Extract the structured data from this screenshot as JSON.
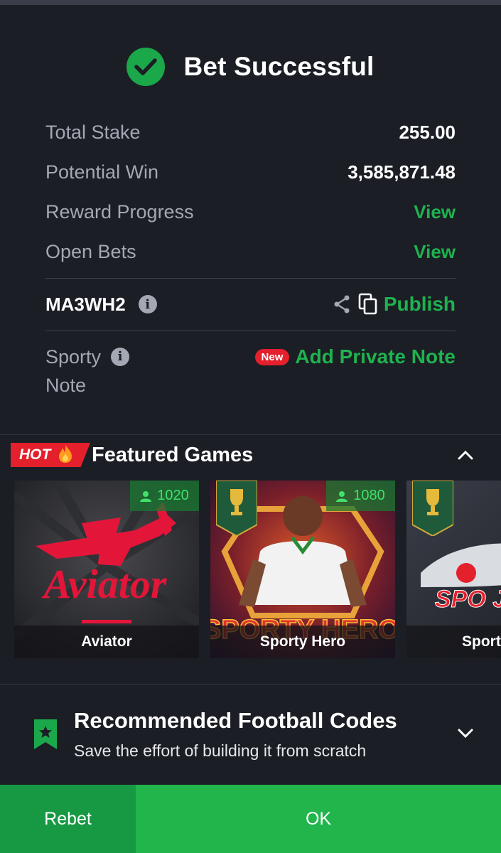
{
  "header": {
    "title": "Bet Successful"
  },
  "summary": {
    "total_stake_label": "Total Stake",
    "total_stake_value": "255.00",
    "potential_win_label": "Potential Win",
    "potential_win_value": "3,585,871.48",
    "reward_progress_label": "Reward Progress",
    "reward_progress_link": "View",
    "open_bets_label": "Open Bets",
    "open_bets_link": "View"
  },
  "booking": {
    "code": "MA3WH2",
    "publish_label": "Publish"
  },
  "note": {
    "label_line1": "Sporty",
    "label_line2": "Note",
    "badge": "New",
    "add_label": "Add Private Note"
  },
  "featured": {
    "hot_label": "HOT",
    "title": "Featured Games",
    "games": [
      {
        "name": "Aviator",
        "players": "1020",
        "logo_text": "Aviator"
      },
      {
        "name": "Sporty Hero",
        "players": "1080",
        "logo_text": "SPORTY HERO"
      },
      {
        "name": "Sporty Jet",
        "players": "",
        "logo_text": "SPO JE"
      }
    ]
  },
  "recommended": {
    "title": "Recommended Football Codes",
    "subtitle": "Save the effort of building it from scratch"
  },
  "buttons": {
    "rebet": "Rebet",
    "ok": "OK"
  },
  "colors": {
    "accent_green": "#1fb24f",
    "ok_button": "#21b54c",
    "rebet_button": "#179943",
    "new_badge": "#e3202c",
    "background": "#1b1e25"
  }
}
